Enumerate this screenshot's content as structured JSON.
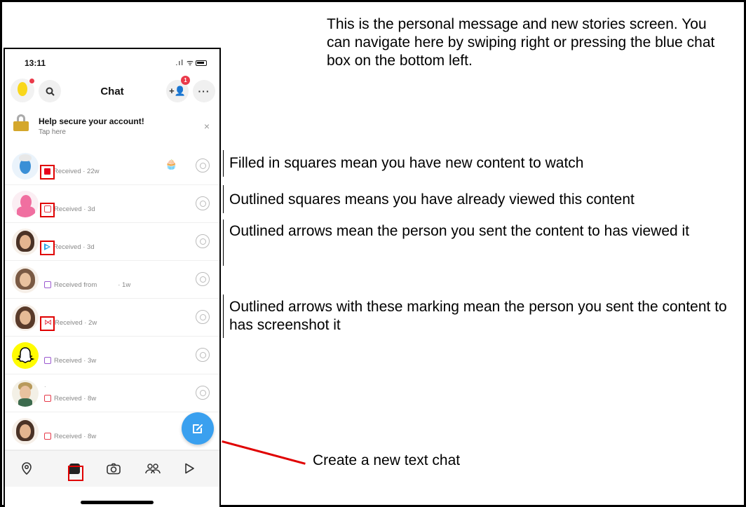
{
  "annotations": {
    "intro": "This is the personal message and new stories screen. You can navigate here by swiping right or pressing the blue chat box on the bottom left.",
    "filled_squares": "Filled in squares mean you have new content to watch",
    "outlined_squares": "Outlined squares means you have already viewed this content",
    "outlined_arrows": "Outlined arrows mean the person you sent the content to has viewed it",
    "screenshot_arrows": "Outlined arrows with these marking mean the person you sent the content to has screenshot it",
    "create_chat": "Create a new text chat"
  },
  "status_bar": {
    "time": "13:11",
    "signal": ".ıl ᯤ"
  },
  "header": {
    "title": "Chat",
    "friend_requests_badge": "1",
    "add_friend_label": "+👤",
    "more_label": "···",
    "search_label": "🔍"
  },
  "secure_banner": {
    "title": "Help secure your account!",
    "subtitle": "Tap here",
    "close": "×"
  },
  "chats": [
    {
      "status": "Received · 22w",
      "indicator": "filled-red-square"
    },
    {
      "status": "Received · 3d",
      "indicator": "outlined-red-square"
    },
    {
      "status": "Received · 3d",
      "indicator": "blue-arrow"
    },
    {
      "status": "Received from",
      "status_extra": "· 1w",
      "indicator": "outlined-purple-square"
    },
    {
      "status": "Received · 2w",
      "indicator": "screenshot-arrow"
    },
    {
      "status": "Received · 3w",
      "indicator": "outlined-purple-square"
    },
    {
      "status": "Received · 8w",
      "indicator": "outlined-red-square",
      "name": "."
    },
    {
      "status": "Received · 8w",
      "indicator": "outlined-red-square"
    }
  ],
  "colors": {
    "accent_blue": "#3aa0ef",
    "unread_red": "#e8001c",
    "annotation_red": "#e00000",
    "purple": "#9b59d0"
  },
  "fab_icon": "new-chat-icon",
  "tabs": [
    "map-icon",
    "chat-icon",
    "camera-icon",
    "stories-icon",
    "spotlight-icon"
  ]
}
